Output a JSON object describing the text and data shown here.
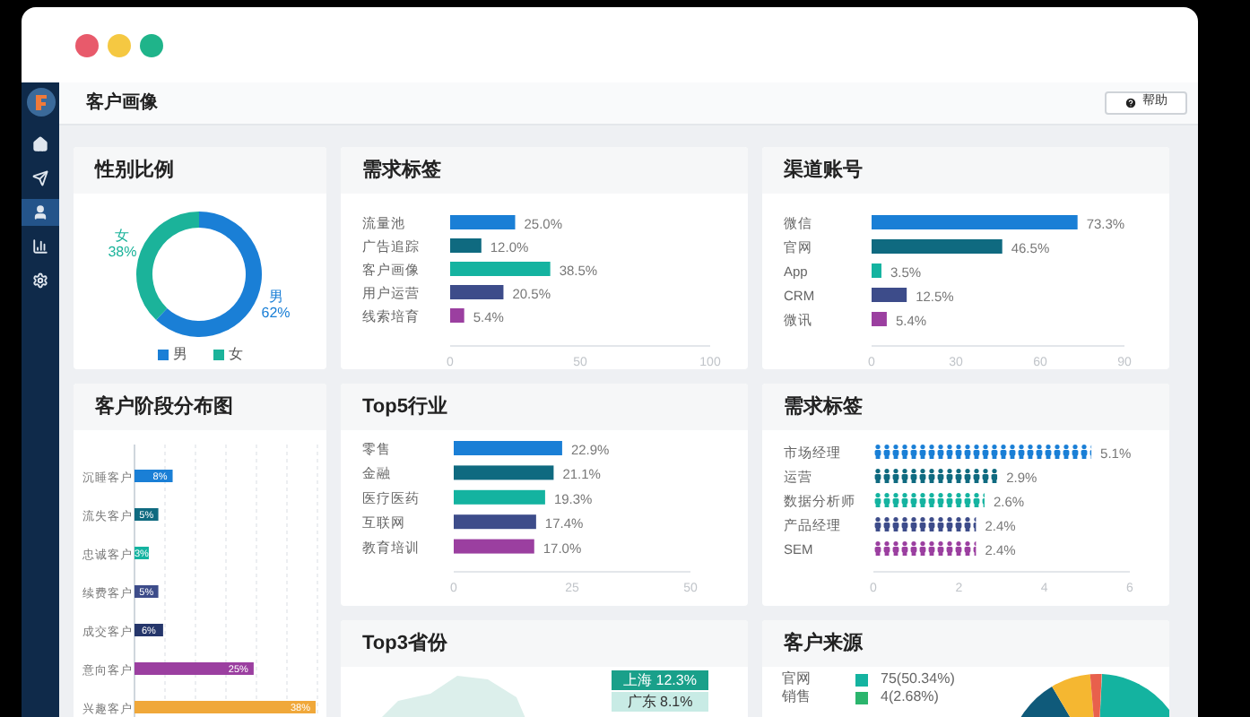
{
  "sidebar": {
    "items": [
      {
        "kind": "home",
        "selected": false
      },
      {
        "kind": "send",
        "selected": false
      },
      {
        "kind": "user",
        "selected": true
      },
      {
        "kind": "chart",
        "selected": false
      },
      {
        "kind": "settings",
        "selected": false
      }
    ]
  },
  "header": {
    "title": "客户画像",
    "help_button": "帮助"
  },
  "gender_ratio": {
    "title": "性别比例",
    "chart_data": {
      "type": "donut",
      "categories": [
        "男",
        "女"
      ],
      "values": [
        62,
        38
      ],
      "value_labels": [
        "62%",
        "38%"
      ]
    },
    "legend": [
      {
        "label": "男",
        "color": "#1a7fd6"
      },
      {
        "label": "女",
        "color": "#1bb39a"
      }
    ]
  },
  "demand_tags": {
    "title": "需求标签",
    "chart_data": {
      "type": "bar",
      "orientation": "horizontal",
      "categories": [
        "流量池",
        "广告追踪",
        "客户画像",
        "用户运营",
        "线索培育"
      ],
      "values": [
        25.0,
        12.0,
        38.5,
        20.5,
        5.4
      ],
      "xlim": [
        0,
        100
      ],
      "xticks": [
        0,
        50,
        100
      ],
      "value_labels": [
        "25.0%",
        "12.0%",
        "38.5%",
        "20.5%",
        "5.4%"
      ]
    }
  },
  "channel_accounts": {
    "title": "渠道账号",
    "chart_data": {
      "type": "bar",
      "orientation": "horizontal",
      "categories": [
        "微信",
        "官网",
        "App",
        "CRM",
        "微讯"
      ],
      "values": [
        73.3,
        46.5,
        3.5,
        12.5,
        5.4
      ],
      "xlim": [
        0,
        90
      ],
      "xticks": [
        0,
        30,
        60,
        90
      ],
      "value_labels": [
        "73.3%",
        "46.5%",
        "3.5%",
        "12.5%",
        "5.4%"
      ]
    }
  },
  "customer_stages": {
    "title": "客户阶段分布图",
    "chart_data": {
      "type": "bar",
      "orientation": "horizontal",
      "categories": [
        "沉睡客户",
        "流失客户",
        "忠诚客户",
        "续费客户",
        "成交客户",
        "意向客户",
        "兴趣客户"
      ],
      "values": [
        8,
        5,
        3,
        5,
        6,
        25,
        38
      ],
      "value_labels": [
        "8%",
        "5%",
        "3%",
        "5%",
        "6%",
        "25%",
        "38%"
      ]
    }
  },
  "top5_industries": {
    "title": "Top5行业",
    "chart_data": {
      "type": "bar",
      "orientation": "horizontal",
      "categories": [
        "零售",
        "金融",
        "医疗医药",
        "互联网",
        "教育培训"
      ],
      "values": [
        22.9,
        21.1,
        19.3,
        17.4,
        17.0
      ],
      "xlim": [
        0,
        50
      ],
      "xticks": [
        0,
        25,
        50
      ],
      "value_labels": [
        "22.9%",
        "21.1%",
        "19.3%",
        "17.4%",
        "17.0%"
      ]
    }
  },
  "role_tags": {
    "title": "需求标签",
    "chart_data": {
      "type": "bar",
      "orientation": "horizontal",
      "categories": [
        "市场经理",
        "运营",
        "数据分析师",
        "产品经理",
        "SEM"
      ],
      "values": [
        5.1,
        2.9,
        2.6,
        2.4,
        2.4
      ],
      "xlim": [
        0,
        6
      ],
      "xticks": [
        0,
        2,
        4,
        6
      ],
      "value_labels": [
        "5.1%",
        "2.9%",
        "2.6%",
        "2.4%",
        "2.4%"
      ]
    }
  },
  "top3_provinces": {
    "title": "Top3省份",
    "badges": [
      {
        "label": "上海 12.3%",
        "color": "#1aa08a"
      },
      {
        "label": "广东 8.1%",
        "color": "#c8ebe5"
      }
    ]
  },
  "customer_sources": {
    "title": "客户来源",
    "legend": [
      {
        "label": "官网",
        "value": "75(50.34%)",
        "color": "#14b3a0"
      },
      {
        "label": "销售",
        "value": "4(2.68%)",
        "color": "#2bb56d"
      }
    ]
  }
}
